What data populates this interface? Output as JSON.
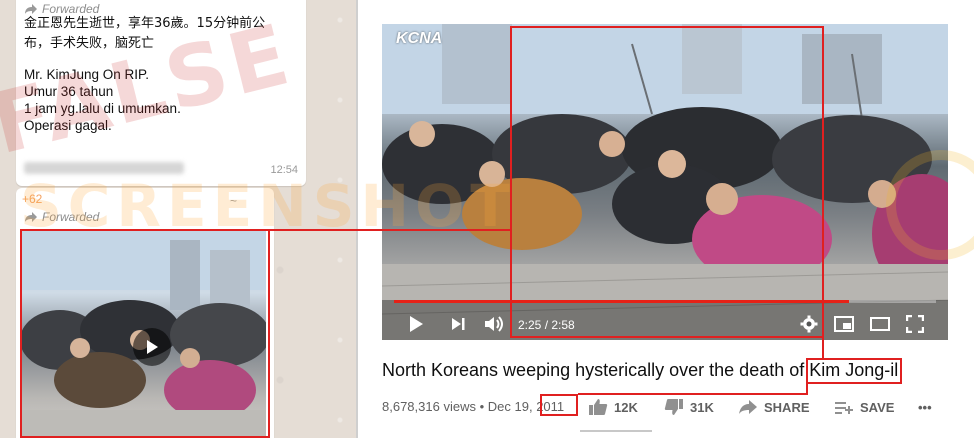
{
  "chat": {
    "bubble1": {
      "forwarded_label": "Forwarded",
      "lines": [
        "金正恩先生逝世，享年36歲。15分钟前公",
        "布，手术失败，脑死亡",
        "Mr. KimJung On RIP.",
        "Umur 36 tahun",
        "1 jam yg.lalu di umumkan.",
        "Operasi gagal."
      ],
      "time": "12:54"
    },
    "bubble2": {
      "sender": "+62",
      "forwarded_label": "Forwarded",
      "wave": "~"
    }
  },
  "video": {
    "channel_logo": "KCNA",
    "time_current": "2:25",
    "time_total": "2:58",
    "progress_fraction": 0.84,
    "title": "North Koreans weeping hysterically over the death of Kim Jong-il",
    "views": "8,678,316 views",
    "date_prefix": "Dec 19,",
    "year": "2011",
    "likes": "12K",
    "dislikes": "31K",
    "share_label": "SHARE",
    "save_label": "SAVE",
    "more_label": "•••"
  },
  "overlays": {
    "stamp_text": "FALSE",
    "watermark_text": "SCREENSHOT"
  },
  "colors": {
    "highlight": "#e02020",
    "progress": "#e62117",
    "chat_bg": "#e5ddd5"
  },
  "icons": [
    "forward-icon",
    "play-icon",
    "next-icon",
    "volume-icon",
    "settings-icon",
    "miniplayer-icon",
    "theater-icon",
    "fullscreen-icon",
    "thumbs-up-icon",
    "thumbs-down-icon",
    "share-icon",
    "add-to-playlist-icon",
    "more-icon"
  ]
}
